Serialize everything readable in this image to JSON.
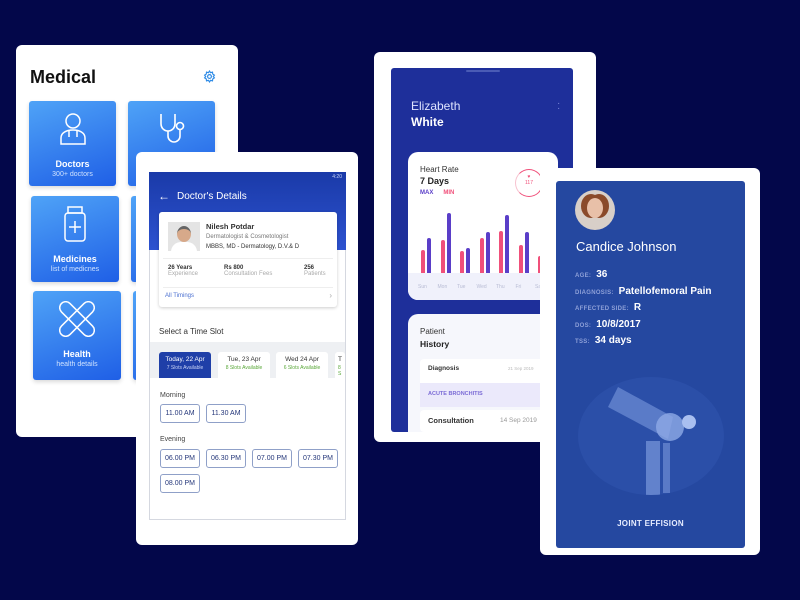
{
  "colors": {
    "background": "#03074a",
    "primary": "#1f3fb3",
    "max": "#5a3ec8",
    "min": "#f0507a",
    "patient_card": "#2548a0"
  },
  "medical": {
    "title": "Medical",
    "settings_icon": "gear-icon",
    "tiles": [
      {
        "title": "Doctors",
        "subtitle": "300+ doctors",
        "icon": "doctor-icon"
      },
      {
        "title": "",
        "subtitle": "",
        "icon": "stethoscope-icon"
      },
      {
        "title": "Medicines",
        "subtitle": "list of medicnes",
        "icon": "medicine-bottle-icon"
      },
      {
        "title": "",
        "subtitle": "",
        "icon": ""
      },
      {
        "title": "Health",
        "subtitle": "health details",
        "icon": "bandage-icon"
      },
      {
        "title": "",
        "subtitle": "",
        "icon": ""
      }
    ]
  },
  "doctor": {
    "status_time": "4:20",
    "title": "Doctor's Details",
    "name": "Nilesh Potdar",
    "specialty": "Dermatologist & Cosmetologist",
    "degrees": "MBBS, MD - Dermatology, D.V.& D",
    "stats": [
      {
        "value": "26 Years",
        "label": "Experience"
      },
      {
        "value": "Rs 800",
        "label": "Consultation Fees"
      },
      {
        "value": "256",
        "label": "Patients"
      }
    ],
    "all_timings": "All Timings",
    "slot_heading": "Select a Time Slot",
    "dates": [
      {
        "date": "Today, 22 Apr",
        "slots": "7 Slots Available",
        "selected": true
      },
      {
        "date": "Tue, 23 Apr",
        "slots": "8 Slots Available"
      },
      {
        "date": "Wed 24 Apr",
        "slots": "6 Slots Available"
      },
      {
        "date": "T",
        "slots": "8 S"
      }
    ],
    "morning_label": "Morning",
    "morning": [
      "11.00 AM",
      "11.30 AM"
    ],
    "evening_label": "Evening",
    "evening": [
      "06.00 PM",
      "06.30 PM",
      "07.00 PM",
      "07.30 PM",
      "08.00 PM"
    ]
  },
  "patient": {
    "first_name": "Elizabeth",
    "last_name": "White",
    "heart_rate": {
      "title": "Heart Rate",
      "period": "7 Days",
      "legend_max": "MAX",
      "legend_min": "MIN",
      "gauge_value": "117"
    },
    "history": {
      "title1": "Patient",
      "title2": "History",
      "diagnosis_label": "Diagnosis",
      "diagnosis_date": "21 Sep 2019",
      "diagnosis_value": "ACUTE BRONCHITIS",
      "consultation_label": "Consultation",
      "consultation_date": "14 Sep 2019"
    }
  },
  "chart_data": {
    "type": "bar",
    "categories": [
      "Sun",
      "Mon",
      "Tue",
      "Wed",
      "Thu",
      "Fri",
      "Sat"
    ],
    "series": [
      {
        "name": "MIN",
        "values": [
          23,
          33,
          22,
          35,
          42,
          28,
          17
        ]
      },
      {
        "name": "MAX",
        "values": [
          35,
          60,
          25,
          41,
          58,
          41,
          null
        ]
      }
    ]
  },
  "case": {
    "name": "Candice Johnson",
    "fields": [
      {
        "label": "AGE:",
        "value": "36"
      },
      {
        "label": "DIAGNOSIS:",
        "value": "Patellofemoral Pain"
      },
      {
        "label": "AFFECTED SIDE:",
        "value": "R"
      },
      {
        "label": "DOS:",
        "value": "10/8/2017"
      },
      {
        "label": "TSS:",
        "value": "34 days"
      }
    ],
    "condition": "JOINT EFFISION"
  }
}
